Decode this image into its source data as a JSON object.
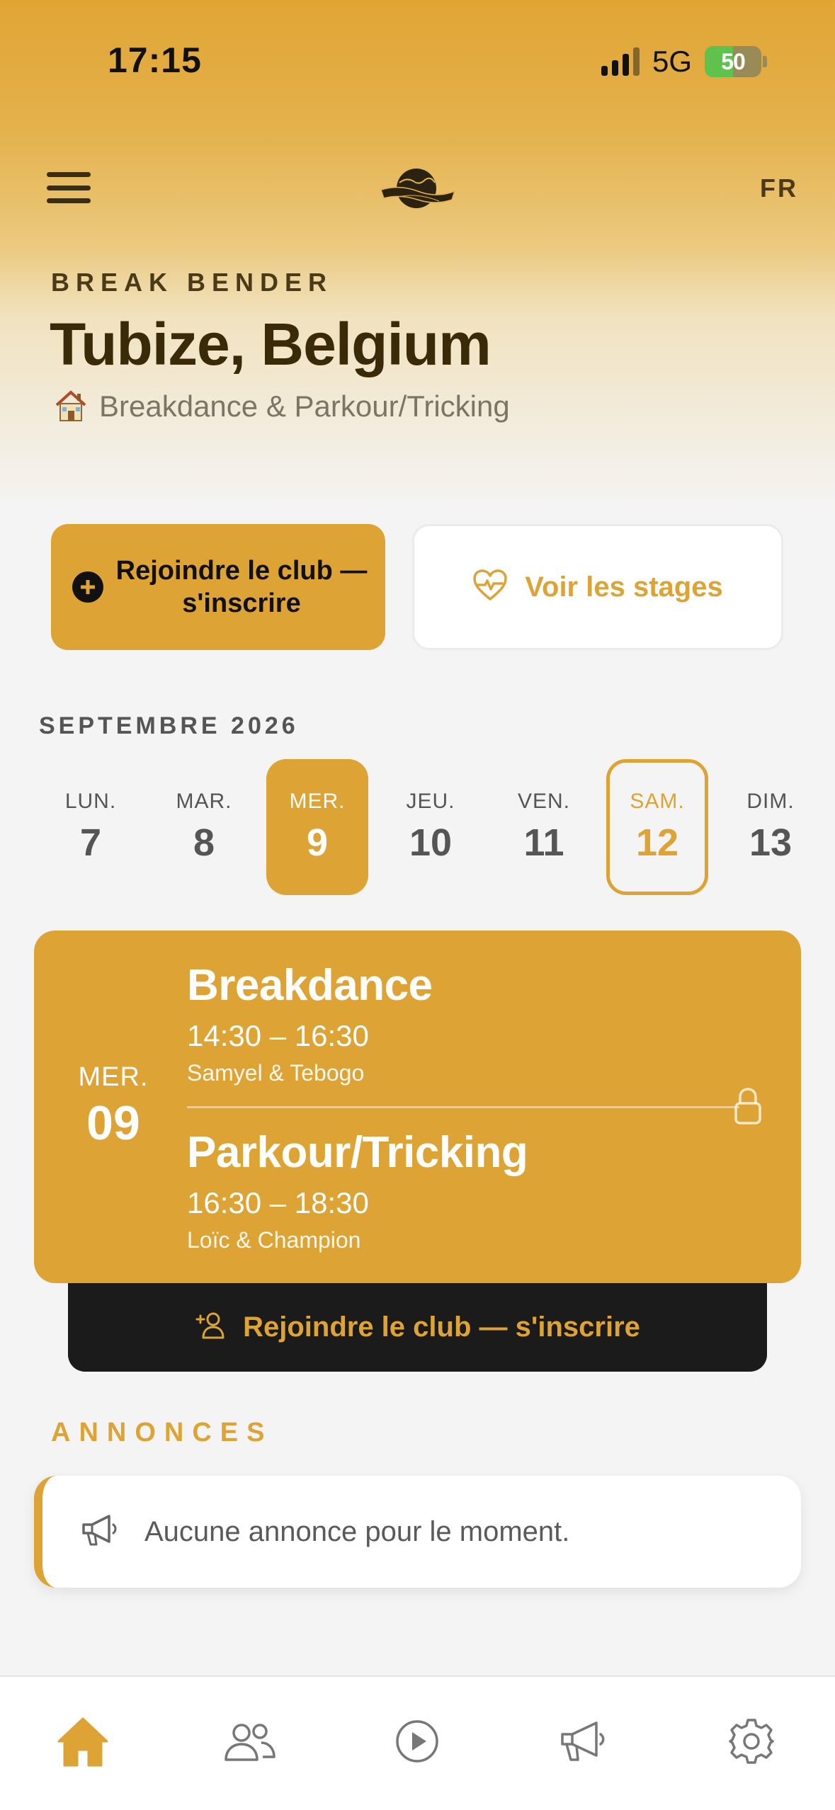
{
  "status_bar": {
    "time": "17:15",
    "network": "5G",
    "battery": "50",
    "battery_fraction": 0.5
  },
  "header": {
    "logo_text": "BREAK BENDER",
    "lang": "FR"
  },
  "club": {
    "brand": "BREAK BENDER",
    "city": "Tubize, Belgium",
    "disciplines": "Breakdance & Parkour/Tricking",
    "house_icon": "house-icon"
  },
  "actions": {
    "join_label": "Rejoindre le club — s'inscrire",
    "stages_label": "Voir les stages"
  },
  "calendar": {
    "month": "SEPTEMBRE 2026",
    "days": [
      {
        "name": "LUN.",
        "num": "7"
      },
      {
        "name": "MAR.",
        "num": "8"
      },
      {
        "name": "MER.",
        "num": "9"
      },
      {
        "name": "JEU.",
        "num": "10"
      },
      {
        "name": "VEN.",
        "num": "11"
      },
      {
        "name": "SAM.",
        "num": "12"
      },
      {
        "name": "DIM.",
        "num": "13"
      }
    ],
    "selected_index": 2,
    "today_index": 5
  },
  "session_card": {
    "day_name": "MER.",
    "day_num": "09",
    "sessions": [
      {
        "title": "Breakdance",
        "time": "14:30 – 16:30",
        "coaches": "Samyel & Tebogo"
      },
      {
        "title": "Parkour/Tricking",
        "time": "16:30 – 18:30",
        "coaches": "Loïc & Champion"
      }
    ],
    "join_label": "Rejoindre le club — s'inscrire"
  },
  "announcements": {
    "title": "ANNONCES",
    "empty_text": "Aucune annonce pour le moment."
  },
  "tabbar": {
    "items": [
      {
        "icon": "home-icon",
        "active": true
      },
      {
        "icon": "users-icon",
        "active": false
      },
      {
        "icon": "play-icon",
        "active": false
      },
      {
        "icon": "megaphone-icon",
        "active": false
      },
      {
        "icon": "settings-icon",
        "active": false
      }
    ]
  },
  "colors": {
    "accent": "#dea335",
    "dark": "#1b1b1b",
    "text_brown": "#3a2a08"
  }
}
